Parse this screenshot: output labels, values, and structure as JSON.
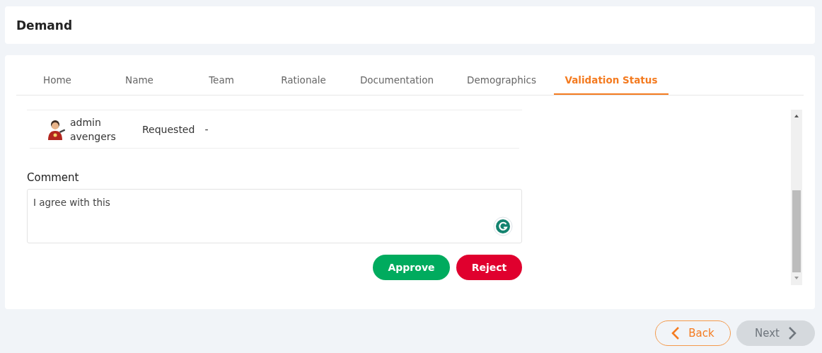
{
  "header": {
    "title": "Demand"
  },
  "tabs": [
    {
      "label": "Home",
      "selected": false
    },
    {
      "label": "Name",
      "selected": false
    },
    {
      "label": "Team",
      "selected": false
    },
    {
      "label": "Rationale",
      "selected": false
    },
    {
      "label": "Documentation",
      "selected": false
    },
    {
      "label": "Demographics",
      "selected": false
    },
    {
      "label": "Validation Status",
      "selected": true
    }
  ],
  "approvals": [
    {
      "user": "admin avengers",
      "status": "Requested",
      "date": "-"
    }
  ],
  "comment": {
    "label": "Comment",
    "value": "I agree with this"
  },
  "actions": [
    {
      "kind": "approve",
      "label": "Approve"
    },
    {
      "kind": "reject",
      "label": "Reject"
    }
  ],
  "navigation": {
    "back": {
      "label": "Back",
      "disabled": false
    },
    "next": {
      "label": "Next",
      "disabled": true
    }
  }
}
